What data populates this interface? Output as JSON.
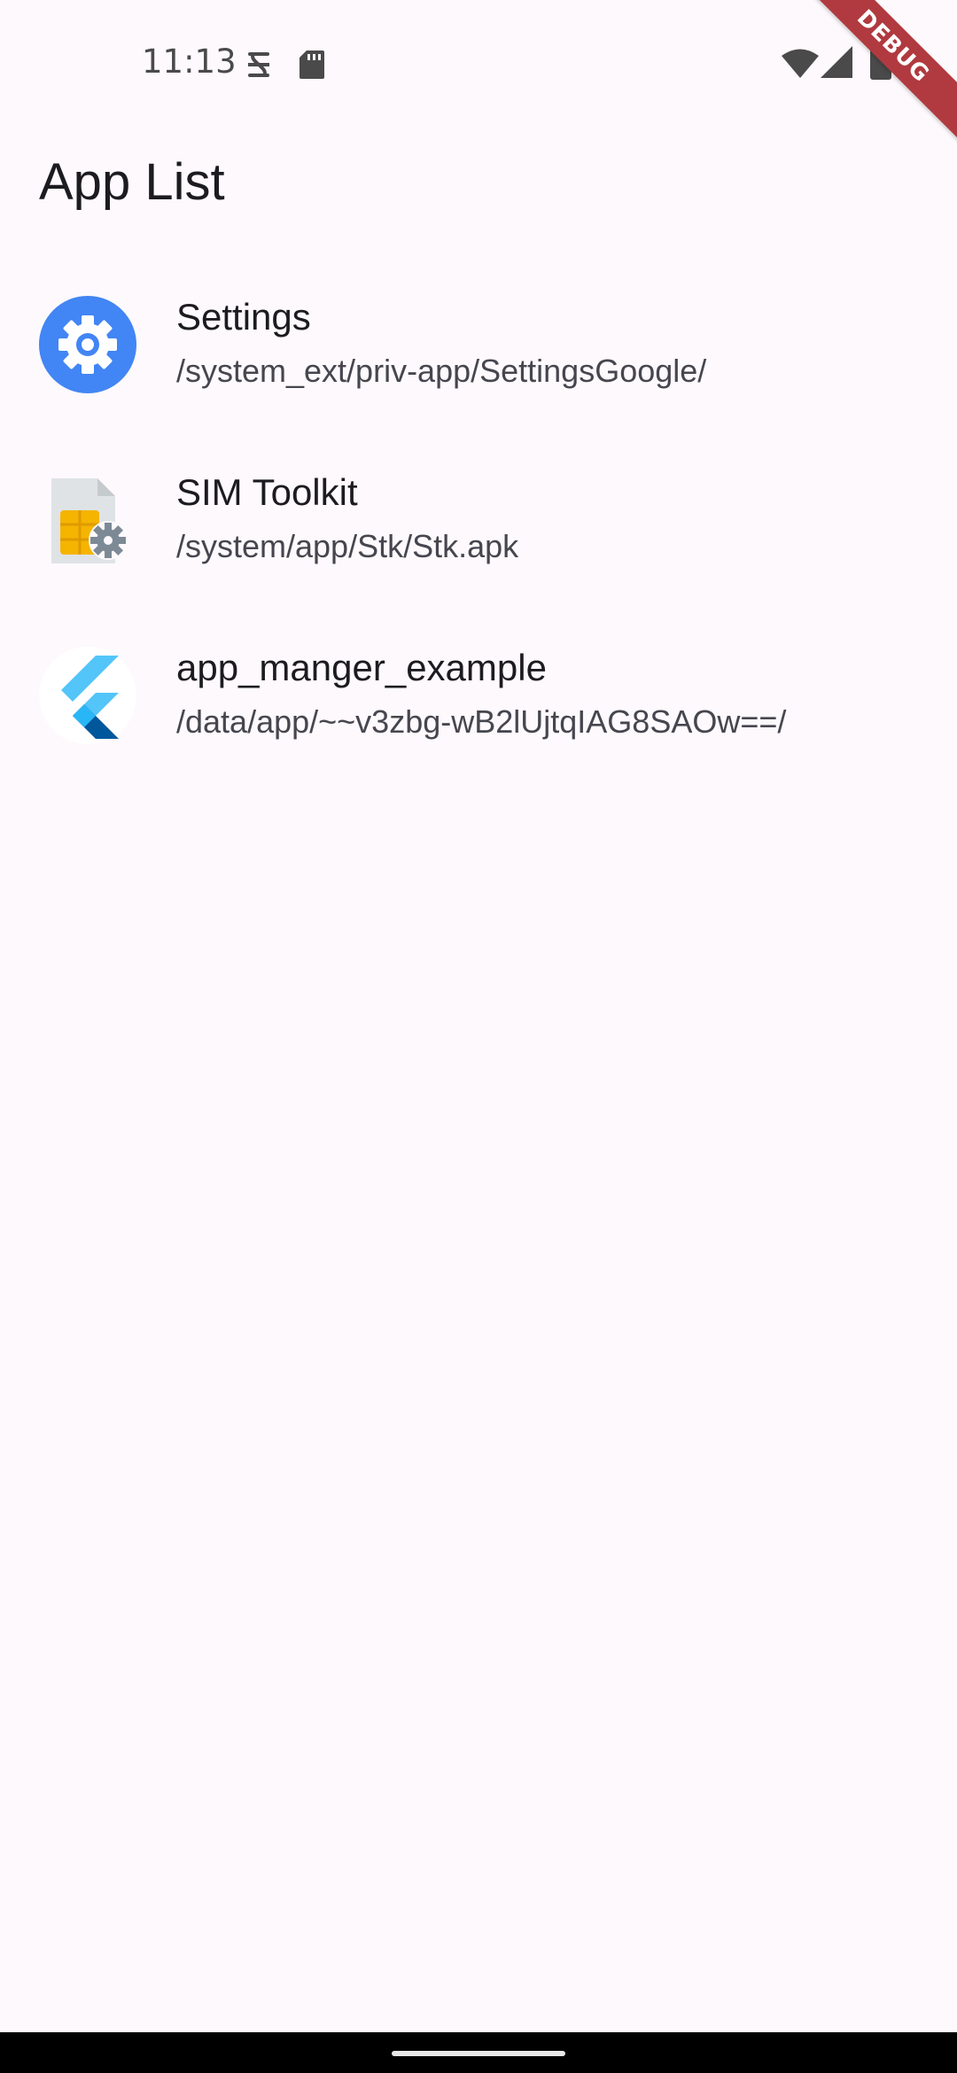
{
  "status_bar": {
    "time": "11:13",
    "icons": [
      "data-saver-icon",
      "sd-card-icon",
      "wifi-icon",
      "signal-icon",
      "battery-icon"
    ]
  },
  "debug_banner": {
    "label": "DEBUG",
    "color": "#b03a3f"
  },
  "app_bar": {
    "title": "App List"
  },
  "apps": [
    {
      "name": "Settings",
      "path": "/system_ext/priv-app/SettingsGoogle/",
      "icon": "settings-gear-icon"
    },
    {
      "name": "SIM Toolkit",
      "path": "/system/app/Stk/Stk.apk",
      "icon": "sim-toolkit-icon"
    },
    {
      "name": "app_manger_example",
      "path": "/data/app/~~v3zbg-wB2lUjtqIAG8SAOw==/",
      "icon": "flutter-logo-icon"
    }
  ],
  "colors": {
    "background": "#fdf9fc",
    "settings_blue": "#4285f4",
    "flutter_light": "#54c5f8",
    "flutter_dark": "#01579b"
  }
}
